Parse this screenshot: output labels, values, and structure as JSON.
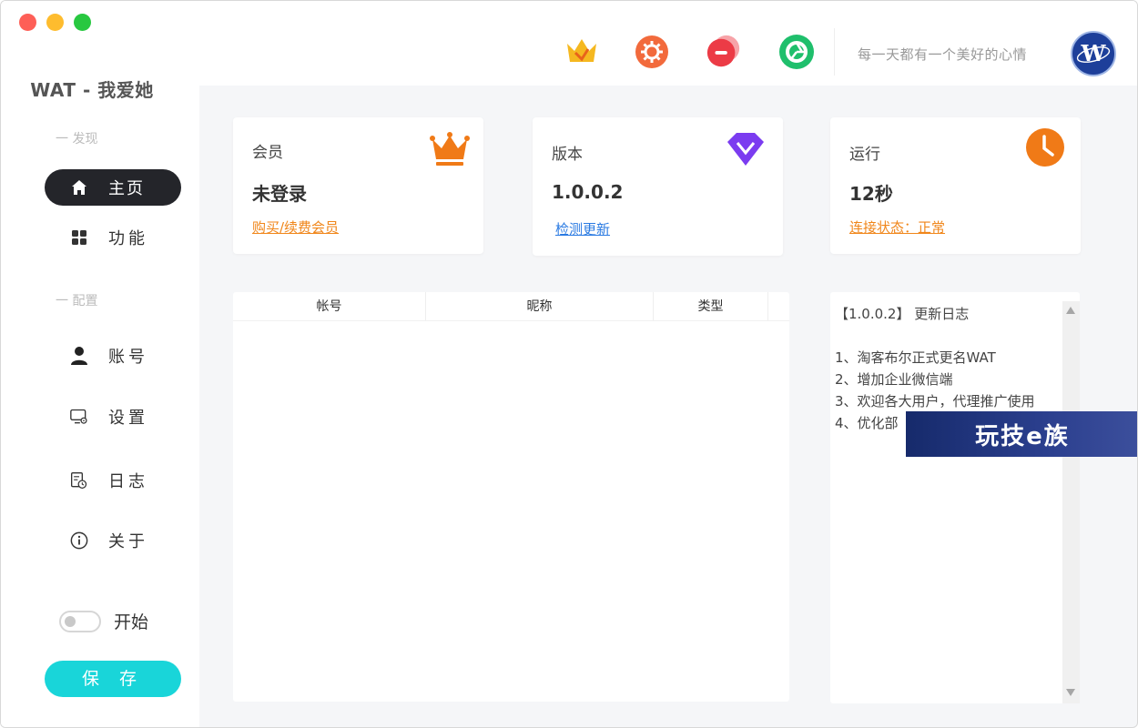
{
  "app": {
    "title": "WAT - 我爱她"
  },
  "sidebar": {
    "section_discover": "一 发现",
    "section_config": "一 配置",
    "items": [
      {
        "label": "主页",
        "icon": "home-icon",
        "active": true
      },
      {
        "label": "功能",
        "icon": "grid-icon",
        "active": false
      },
      {
        "label": "账号",
        "icon": "user-icon",
        "active": false
      },
      {
        "label": "设置",
        "icon": "monitor-settings-icon",
        "active": false
      },
      {
        "label": "日志",
        "icon": "log-clock-icon",
        "active": false
      },
      {
        "label": "关于",
        "icon": "info-icon",
        "active": false
      }
    ],
    "toggle_label": "开始",
    "save_label": "保 存"
  },
  "topbar": {
    "icons": [
      "crown-vip-icon",
      "settings-gear-icon",
      "chat-bubble-icon",
      "shutter-icon"
    ],
    "motto": "每一天都有一个美好的心情",
    "avatar": "W"
  },
  "cards": {
    "member": {
      "title": "会员",
      "value": "未登录",
      "link": "购买/续费会员",
      "link_color": "#f0861a"
    },
    "version": {
      "title": "版本",
      "value": "1.0.0.2",
      "link": "检测更新",
      "link_color": "#2a7ae2"
    },
    "runtime": {
      "title": "运行",
      "value": "12秒",
      "link": "连接状态：正常",
      "link_color": "#f0861a"
    }
  },
  "table": {
    "columns": [
      "帐号",
      "昵称",
      "类型"
    ],
    "rows": []
  },
  "changelog": {
    "title": "【1.0.0.2】 更新日志",
    "lines": [
      "1、淘客布尔正式更名WAT",
      "2、增加企业微信端",
      "3、欢迎各大用户，代理推广使用",
      "4、优化部"
    ]
  },
  "watermark": {
    "text": "玩技e族"
  },
  "colors": {
    "accent_cyan": "#19d5d9",
    "active_nav": "#24252a",
    "orange": "#f07a17",
    "purple": "#7b3cf0"
  }
}
